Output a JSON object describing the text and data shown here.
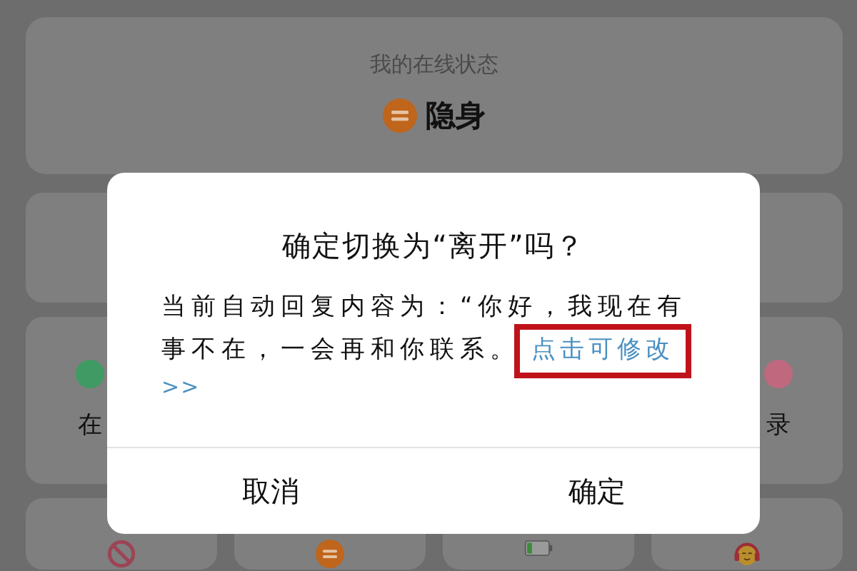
{
  "status_card": {
    "title": "我的在线状态",
    "current": {
      "label": "隐身"
    }
  },
  "status_grid": {
    "row_2": [
      {
        "label": "在",
        "color": "#3f9b63"
      },
      {
        "label": "录",
        "color": "#c0687e"
      }
    ],
    "row_3": [
      {
        "kind": "forbidden"
      },
      {
        "kind": "equals"
      },
      {
        "kind": "battery"
      },
      {
        "kind": "face"
      }
    ]
  },
  "dialog": {
    "title": "确定切换为“离开”吗？",
    "message": "当前自动回复内容为：“你好，我现在有事不在，一会再和你联系。",
    "link": "点击可修改",
    "link_arrow": ">>",
    "link_highlighted": true,
    "buttons": [
      "取消",
      "确定"
    ]
  }
}
